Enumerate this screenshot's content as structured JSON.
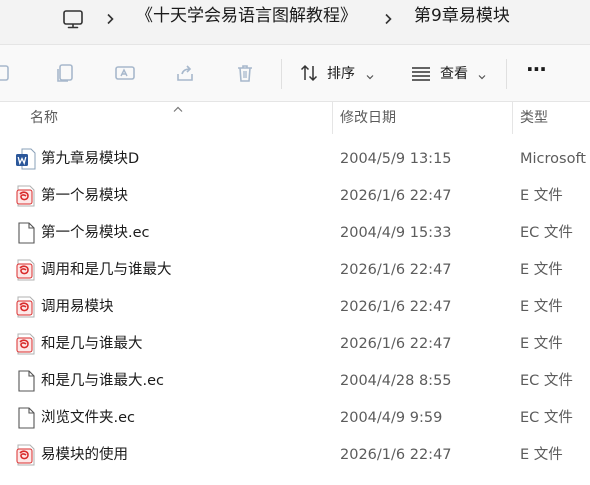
{
  "breadcrumb": {
    "icon": "computer-icon",
    "items": [
      "《十天学会易语言图解教程》",
      "第9章易模块"
    ]
  },
  "toolbar": {
    "sort_label": "排序",
    "view_label": "查看",
    "more_label": "···"
  },
  "columns": {
    "name": "名称",
    "date": "修改日期",
    "type": "类型"
  },
  "files": [
    {
      "name": "第九章易模块D",
      "date": "2004/5/9 13:15",
      "type": "Microsoft",
      "icon": "word-doc-icon"
    },
    {
      "name": "第一个易模块",
      "date": "2026/1/6 22:47",
      "type": "E 文件",
      "icon": "e-file-icon"
    },
    {
      "name": "第一个易模块.ec",
      "date": "2004/4/9 15:33",
      "type": "EC 文件",
      "icon": "blank-file-icon"
    },
    {
      "name": "调用和是几与谁最大",
      "date": "2026/1/6 22:47",
      "type": "E 文件",
      "icon": "e-file-icon"
    },
    {
      "name": "调用易模块",
      "date": "2026/1/6 22:47",
      "type": "E 文件",
      "icon": "e-file-icon"
    },
    {
      "name": "和是几与谁最大",
      "date": "2026/1/6 22:47",
      "type": "E 文件",
      "icon": "e-file-icon"
    },
    {
      "name": "和是几与谁最大.ec",
      "date": "2004/4/28 8:55",
      "type": "EC 文件",
      "icon": "blank-file-icon"
    },
    {
      "name": "浏览文件夹.ec",
      "date": "2004/4/9 9:59",
      "type": "EC 文件",
      "icon": "blank-file-icon"
    },
    {
      "name": "易模块的使用",
      "date": "2026/1/6 22:47",
      "type": "E 文件",
      "icon": "e-file-icon"
    }
  ],
  "colors": {
    "accent": "#2b579a",
    "e_icon_red": "#d92b2b"
  }
}
